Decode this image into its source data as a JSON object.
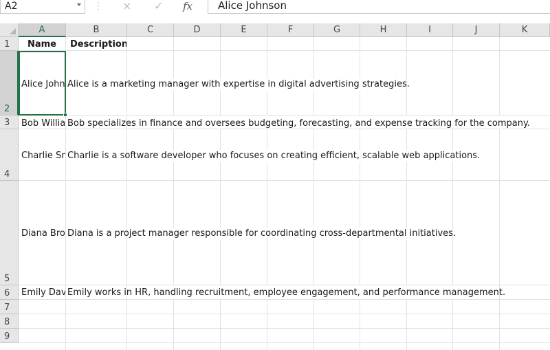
{
  "formula_bar": {
    "name_box": "A2",
    "cancel_icon": "×",
    "enter_icon": "✓",
    "fx_label": "fx",
    "value": "Alice Johnson"
  },
  "columns": [
    "A",
    "B",
    "C",
    "D",
    "E",
    "F",
    "G",
    "H",
    "I",
    "J",
    "K"
  ],
  "rows": [
    "1",
    "2",
    "3",
    "4",
    "5",
    "6",
    "7",
    "8",
    "9"
  ],
  "header_row": {
    "name": "Name",
    "description": "Description"
  },
  "people": [
    {
      "name": "Alice John",
      "description": "Alice is a marketing manager with expertise in digital advertising strategies."
    },
    {
      "name": "Bob Williar",
      "description": "Bob specializes in finance and oversees budgeting, forecasting, and expense tracking for the company."
    },
    {
      "name": "Charlie Sm",
      "description": "Charlie is a software developer who focuses on creating efficient, scalable web applications."
    },
    {
      "name": "Diana Brov",
      "description": "Diana is a project manager responsible for coordinating cross-departmental initiatives."
    },
    {
      "name": "Emily Davi",
      "description": "Emily works in HR, handling recruitment, employee engagement, and performance management."
    }
  ],
  "accent_color": "#217346"
}
